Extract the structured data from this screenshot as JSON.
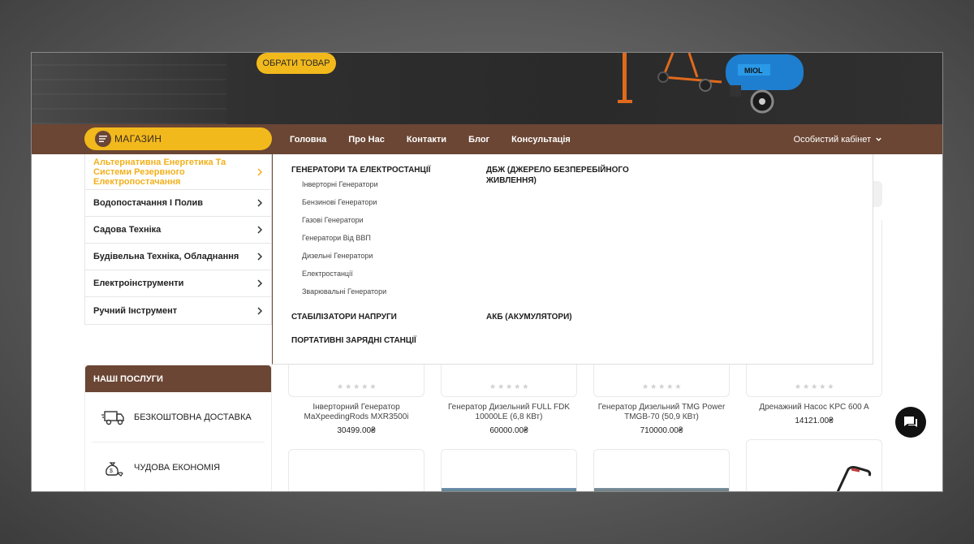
{
  "hero": {
    "cta_label": "ОБРАТИ ТОВАР"
  },
  "nav": {
    "shop_label": "МАГАЗИН",
    "links": [
      "Головна",
      "Про Нас",
      "Контакти",
      "Блог",
      "Консультація"
    ],
    "account_label": "Особистий кабінет"
  },
  "categories": [
    {
      "label": "Альтернативна Енергетика Та Системи Резервного Електропостачання"
    },
    {
      "label": "Водопостачання І Полив"
    },
    {
      "label": "Садова Техніка"
    },
    {
      "label": "Будівельна Техніка, Обладнання"
    },
    {
      "label": "Електроінструменти"
    },
    {
      "label": "Ручний Інструмент"
    }
  ],
  "mega": {
    "col1": {
      "head": "ГЕНЕРАТОРИ ТА ЕЛЕКТРОСТАНЦІЇ",
      "items": [
        "Інверторні Генератори",
        "Бензинові Генератори",
        "Газові Генератори",
        "Генератори Від ВВП",
        "Дизельні Генератори",
        "Електростанції",
        "Зварювальні Генератори"
      ],
      "head2": "СТАБІЛІЗАТОРИ НАПРУГИ",
      "head3": "ПОРТАТИВНІ ЗАРЯДНІ СТАНЦІЇ"
    },
    "col2": {
      "head": "ДБЖ (ДЖЕРЕЛО БЕЗПЕРЕБІЙНОГО ЖИВЛЕННЯ)",
      "head2": "АКБ (АКУМУЛЯТОРИ)"
    }
  },
  "services": {
    "title": "НАШІ ПОСЛУГИ",
    "items": [
      {
        "label": "БЕЗКОШТОВНА ДОСТАВКА",
        "icon": "truck-icon"
      },
      {
        "label": "ЧУДОВА ЕКОНОМІЯ",
        "icon": "money-bag-icon"
      }
    ]
  },
  "products": [
    {
      "name": "Інверторний Генератор MaXpeedingRods MXR3500i",
      "price": "30499.00₴"
    },
    {
      "name": "Генератор Дизельний FULL FDK 10000LE (6,8 КВт)",
      "price": "60000.00₴"
    },
    {
      "name": "Генератор Дизельний TMG Power TMGB-70 (50,9 КВт)",
      "price": "710000.00₴"
    },
    {
      "name": "Дренажний Насос KPC 600 A",
      "price": "14121.00₴"
    }
  ],
  "colors": {
    "brand_brown": "#6b4634",
    "accent_yellow": "#f2b91c"
  }
}
